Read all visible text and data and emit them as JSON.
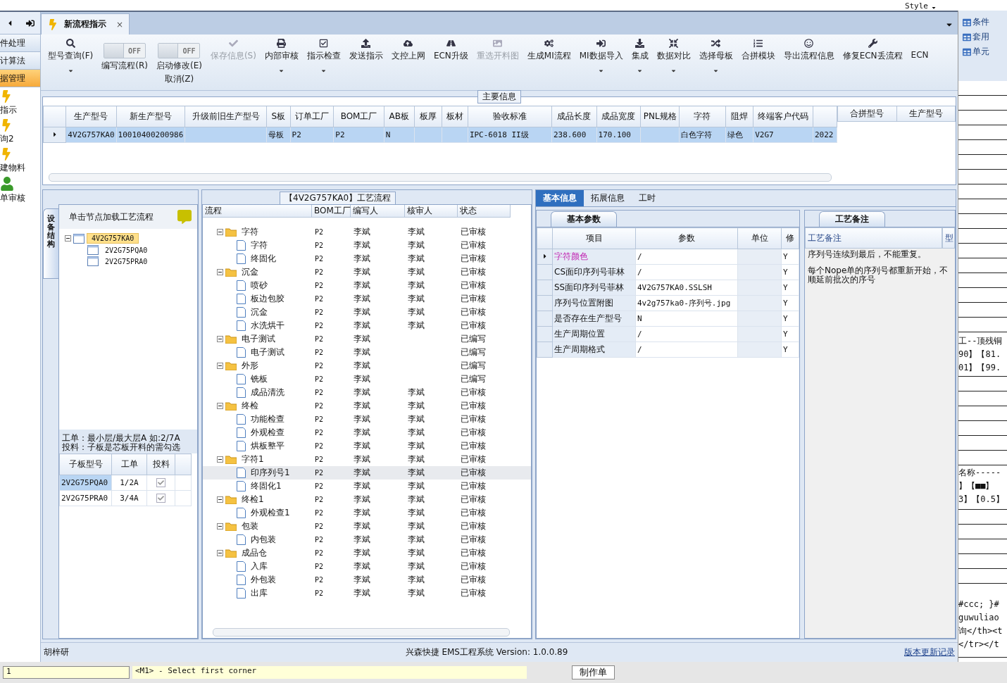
{
  "top_strip": {
    "style_menu": "Style"
  },
  "nav": {
    "items": [
      {
        "label": "件处理",
        "kind": "text",
        "selected": false
      },
      {
        "label": "计算法",
        "kind": "text",
        "selected": false
      },
      {
        "label": "据管理",
        "kind": "text",
        "selected": true
      },
      {
        "label": "指示",
        "kind": "bolt",
        "selected": false
      },
      {
        "label": "询2",
        "kind": "bolt",
        "selected": false
      },
      {
        "label": "建物料",
        "kind": "bolt",
        "selected": false
      },
      {
        "label": "单审核",
        "kind": "person",
        "selected": false
      }
    ]
  },
  "doc_tab": {
    "title": "新流程指示",
    "close": "×",
    "selected": true
  },
  "toolbar": [
    {
      "kind": "button",
      "label": "型号查询(F)",
      "disabled": false,
      "dropdown": true
    },
    {
      "kind": "toggle",
      "switch_text": "OFF",
      "label": "编写流程(R)",
      "on": false
    },
    {
      "kind": "toggle",
      "switch_text": "OFF",
      "label": "启动修改(E)",
      "sub_label": "取消(Z)",
      "on": false
    },
    {
      "kind": "button",
      "label": "保存信息(S)",
      "disabled": true,
      "dropdown": false
    },
    {
      "kind": "button",
      "label": "内部审核",
      "disabled": false,
      "dropdown": true
    },
    {
      "kind": "button",
      "label": "指示检查",
      "disabled": false,
      "dropdown": true
    },
    {
      "kind": "button",
      "label": "发送指示",
      "disabled": false,
      "dropdown": false
    },
    {
      "kind": "button",
      "label": "文控上网",
      "disabled": false,
      "dropdown": false
    },
    {
      "kind": "button",
      "label": "ECN升级",
      "disabled": false,
      "dropdown": false
    },
    {
      "kind": "button",
      "label": "重选开料图",
      "disabled": true,
      "dropdown": false
    },
    {
      "kind": "button",
      "label": "生成MI流程",
      "disabled": false,
      "dropdown": false
    },
    {
      "kind": "button",
      "label": "MI数据导入",
      "disabled": false,
      "dropdown": true
    },
    {
      "kind": "button",
      "label": "集成",
      "disabled": false,
      "dropdown": true
    },
    {
      "kind": "button",
      "label": "数据对比",
      "disabled": false,
      "dropdown": true
    },
    {
      "kind": "button",
      "label": "选择母板",
      "disabled": false,
      "dropdown": true
    },
    {
      "kind": "button",
      "label": "合拼模块",
      "disabled": false,
      "dropdown": false
    },
    {
      "kind": "button",
      "label": "导出流程信息",
      "disabled": false,
      "dropdown": false
    },
    {
      "kind": "button",
      "label": "修复ECN丢流程",
      "disabled": false,
      "dropdown": false
    },
    {
      "kind": "button",
      "label": "ECN",
      "disabled": false,
      "dropdown": false
    }
  ],
  "main_info": {
    "title": "主要信息",
    "columns": [
      "生产型号",
      "新生产型号",
      "升级前旧生产型号",
      "S板",
      "订单工厂",
      "BOM工厂",
      "AB板",
      "板厚",
      "板材",
      "验收标准",
      "成品长度",
      "成品宽度",
      "PNL规格",
      "字符",
      "阻焊",
      "终端客户代码"
    ],
    "rows": [
      {
        "selected": true,
        "cells": [
          "4V2G757KA0",
          "10010400200986",
          "",
          "母板",
          "P2",
          "P2",
          "N",
          "",
          "",
          "IPC-6018 II级",
          "238.600",
          "170.100",
          "",
          "白色字符",
          "绿色",
          "V2G7",
          "2022"
        ]
      }
    ],
    "side_columns": [
      "合拼型号",
      "生产型号"
    ]
  },
  "structure": {
    "side_tab": "设备结构",
    "hint": "单击节点加载工艺流程",
    "tree": [
      {
        "label": "4V2G757KA0",
        "selected": true,
        "expanded": true,
        "children": [
          {
            "label": "2V2G75PQA0",
            "selected": false
          },
          {
            "label": "2V2G75PRA0",
            "selected": false
          }
        ]
      }
    ],
    "note_lines": [
      "工单：最小层/最大层A 如:2/7A",
      "投料：子板是芯板开料的需勾选"
    ],
    "columns": [
      "子板型号",
      "工单",
      "投料"
    ],
    "rows": [
      {
        "board": "2V2G75PQA0",
        "order": "1/2A",
        "checked": true,
        "selected": true
      },
      {
        "board": "2V2G75PRA0",
        "order": "3/4A",
        "checked": true,
        "selected": false
      }
    ]
  },
  "flow": {
    "title": "【4V2G757KA0】工艺流程",
    "columns": [
      "流程",
      "BOM工厂",
      "编写人",
      "核审人",
      "状态"
    ],
    "tree": [
      {
        "label": "字符",
        "bom": "P2",
        "writer": "李斌",
        "checker": "李斌",
        "status": "已审核",
        "selected": false,
        "expanded": true,
        "children": [
          {
            "label": "字符",
            "bom": "P2",
            "writer": "李斌",
            "checker": "李斌",
            "status": "已审核",
            "selected": false
          },
          {
            "label": "终固化",
            "bom": "P2",
            "writer": "李斌",
            "checker": "李斌",
            "status": "已审核",
            "selected": false
          }
        ]
      },
      {
        "label": "沉金",
        "bom": "P2",
        "writer": "李斌",
        "checker": "李斌",
        "status": "已审核",
        "selected": false,
        "expanded": true,
        "children": [
          {
            "label": "喷砂",
            "bom": "P2",
            "writer": "李斌",
            "checker": "李斌",
            "status": "已审核",
            "selected": false
          },
          {
            "label": "板边包胶",
            "bom": "P2",
            "writer": "李斌",
            "checker": "李斌",
            "status": "已审核",
            "selected": false
          },
          {
            "label": "沉金",
            "bom": "P2",
            "writer": "李斌",
            "checker": "李斌",
            "status": "已审核",
            "selected": false
          },
          {
            "label": "水洗烘干",
            "bom": "P2",
            "writer": "李斌",
            "checker": "李斌",
            "status": "已审核",
            "selected": false
          }
        ]
      },
      {
        "label": "电子测试",
        "bom": "P2",
        "writer": "李斌",
        "status": "已编写",
        "selected": false,
        "expanded": true,
        "children": [
          {
            "label": "电子测试",
            "bom": "P2",
            "writer": "李斌",
            "status": "已编写",
            "selected": false
          }
        ]
      },
      {
        "label": "外形",
        "bom": "P2",
        "writer": "李斌",
        "status": "已编写",
        "selected": false,
        "expanded": true,
        "children": [
          {
            "label": "铣板",
            "bom": "P2",
            "writer": "李斌",
            "status": "已编写",
            "selected": false
          },
          {
            "label": "成品清洗",
            "bom": "P2",
            "writer": "李斌",
            "checker": "李斌",
            "status": "已审核",
            "selected": false
          }
        ]
      },
      {
        "label": "终检",
        "bom": "P2",
        "writer": "李斌",
        "checker": "李斌",
        "status": "已审核",
        "selected": false,
        "expanded": true,
        "children": [
          {
            "label": "功能检查",
            "bom": "P2",
            "writer": "李斌",
            "checker": "李斌",
            "status": "已审核",
            "selected": false
          },
          {
            "label": "外观检查",
            "bom": "P2",
            "writer": "李斌",
            "checker": "李斌",
            "status": "已审核",
            "selected": false
          },
          {
            "label": "烘板整平",
            "bom": "P2",
            "writer": "李斌",
            "checker": "李斌",
            "status": "已审核",
            "selected": false
          }
        ]
      },
      {
        "label": "字符1",
        "bom": "P2",
        "writer": "李斌",
        "checker": "李斌",
        "status": "已审核",
        "selected": false,
        "expanded": true,
        "children": [
          {
            "label": "印序列号1",
            "bom": "P2",
            "writer": "李斌",
            "checker": "李斌",
            "status": "已审核",
            "selected": true
          },
          {
            "label": "终固化1",
            "bom": "P2",
            "writer": "李斌",
            "checker": "李斌",
            "status": "已审核",
            "selected": false
          }
        ]
      },
      {
        "label": "终检1",
        "bom": "P2",
        "writer": "李斌",
        "checker": "李斌",
        "status": "已审核",
        "selected": false,
        "expanded": true,
        "children": [
          {
            "label": "外观检查1",
            "bom": "P2",
            "writer": "李斌",
            "checker": "李斌",
            "status": "已审核",
            "selected": false
          }
        ]
      },
      {
        "label": "包装",
        "bom": "P2",
        "writer": "李斌",
        "checker": "李斌",
        "status": "已审核",
        "selected": false,
        "expanded": true,
        "children": [
          {
            "label": "内包装",
            "bom": "P2",
            "writer": "李斌",
            "checker": "李斌",
            "status": "已审核",
            "selected": false
          }
        ]
      },
      {
        "label": "成品仓",
        "bom": "P2",
        "writer": "李斌",
        "checker": "李斌",
        "status": "已审核",
        "selected": false,
        "expanded": true,
        "children": [
          {
            "label": "入库",
            "bom": "P2",
            "writer": "李斌",
            "checker": "李斌",
            "status": "已审核",
            "selected": false
          },
          {
            "label": "外包装",
            "bom": "P2",
            "writer": "李斌",
            "checker": "李斌",
            "status": "已审核",
            "selected": false
          },
          {
            "label": "出库",
            "bom": "P2",
            "writer": "李斌",
            "checker": "李斌",
            "status": "已审核",
            "selected": false
          }
        ]
      }
    ]
  },
  "detail_tabs": [
    {
      "label": "基本信息",
      "selected": true
    },
    {
      "label": "拓展信息",
      "selected": false
    },
    {
      "label": "工时",
      "selected": false
    }
  ],
  "params": {
    "tab": "基本参数",
    "columns": [
      "项目",
      "参数",
      "单位",
      "修"
    ],
    "rows": [
      {
        "item": "字符颜色",
        "value": "/",
        "unit": "",
        "flag": "Y",
        "selected": true
      },
      {
        "item": "CS面印序列号菲林",
        "value": "/",
        "unit": "",
        "flag": "Y",
        "selected": false
      },
      {
        "item": "SS面印序列号菲林",
        "value": "4V2G757KA0.SSLSH",
        "unit": "",
        "flag": "Y",
        "selected": false
      },
      {
        "item": "序列号位置附图",
        "value": "4v2g757ka0-序列号.jpg",
        "unit": "",
        "flag": "Y",
        "selected": false
      },
      {
        "item": "是否存在生产型号",
        "value": "N",
        "unit": "",
        "flag": "Y",
        "selected": false
      },
      {
        "item": "生产周期位置",
        "value": "/",
        "unit": "",
        "flag": "Y",
        "selected": false
      },
      {
        "item": "生产周期格式",
        "value": "/",
        "unit": "",
        "flag": "Y",
        "selected": false
      }
    ]
  },
  "remarks": {
    "tab": "工艺备注",
    "column": "工艺备注",
    "column_2": "型",
    "paragraphs": [
      "序列号连续到最后，不能重复。",
      "每个Nope单的序列号都重新开始，不顺延前批次的序号"
    ]
  },
  "status_bar": {
    "user": "胡梓研",
    "product": "兴森快捷 EMS工程系统 Version: 1.0.0.89",
    "link": "版本更新记录"
  },
  "side_window": {
    "items": [
      "条件",
      "套用",
      "单元"
    ],
    "text_blocks": [
      [
        "工--顶残铜",
        "90】【81.",
        "01】【99."
      ],
      [
        "名称-----",
        "】【■■】",
        "3】【0.5】"
      ],
      [
        "#ccc; }#",
        "guwuliao",
        "询</th><t",
        "</tr></t"
      ]
    ]
  },
  "bottom_strip": {
    "field": "1",
    "command": "<M1> - Select first corner",
    "sheet_tab": "制作单"
  }
}
